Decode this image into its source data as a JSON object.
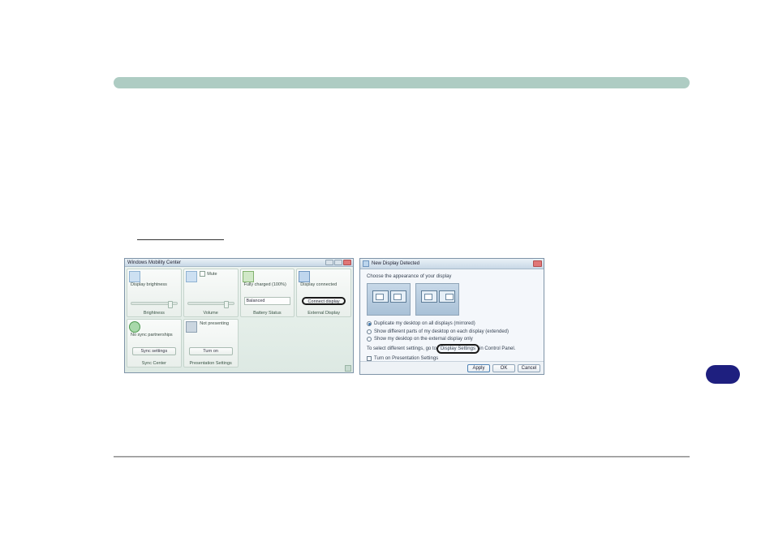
{
  "bar": {
    "aria": "section-divider"
  },
  "wmc": {
    "title": "Windows Mobility Center",
    "tiles": {
      "brightness": {
        "label": "Display\nbrightness",
        "foot": "Brightness"
      },
      "volume": {
        "label": "Mute",
        "foot": "Volume"
      },
      "battery": {
        "label": "Fully charged\n(100%)",
        "select": "Balanced",
        "foot": "Battery Status"
      },
      "display": {
        "label": "Display\nconnected",
        "btn": "Connect display",
        "foot": "External Display"
      },
      "sync": {
        "label": "No sync\npartnerships",
        "btn": "Sync settings",
        "foot": "Sync Center"
      },
      "present": {
        "label": "Not presenting",
        "btn": "Turn on",
        "foot": "Presentation Settings"
      }
    }
  },
  "ndd": {
    "title": "New Display Detected",
    "instr": "Choose the appearance of your display",
    "opt1": "Duplicate my desktop on all displays (mirrored)",
    "opt2": "Show different parts of my desktop on each display (extended)",
    "opt3": "Show my desktop on the external display only",
    "linkline_pre": "To select different settings, go to ",
    "linkline_link": "Display Settings",
    "linkline_post": " in Control Panel.",
    "remember": "Turn on Presentation Settings",
    "apply": "Apply",
    "ok": "OK",
    "cancel": "Cancel"
  }
}
